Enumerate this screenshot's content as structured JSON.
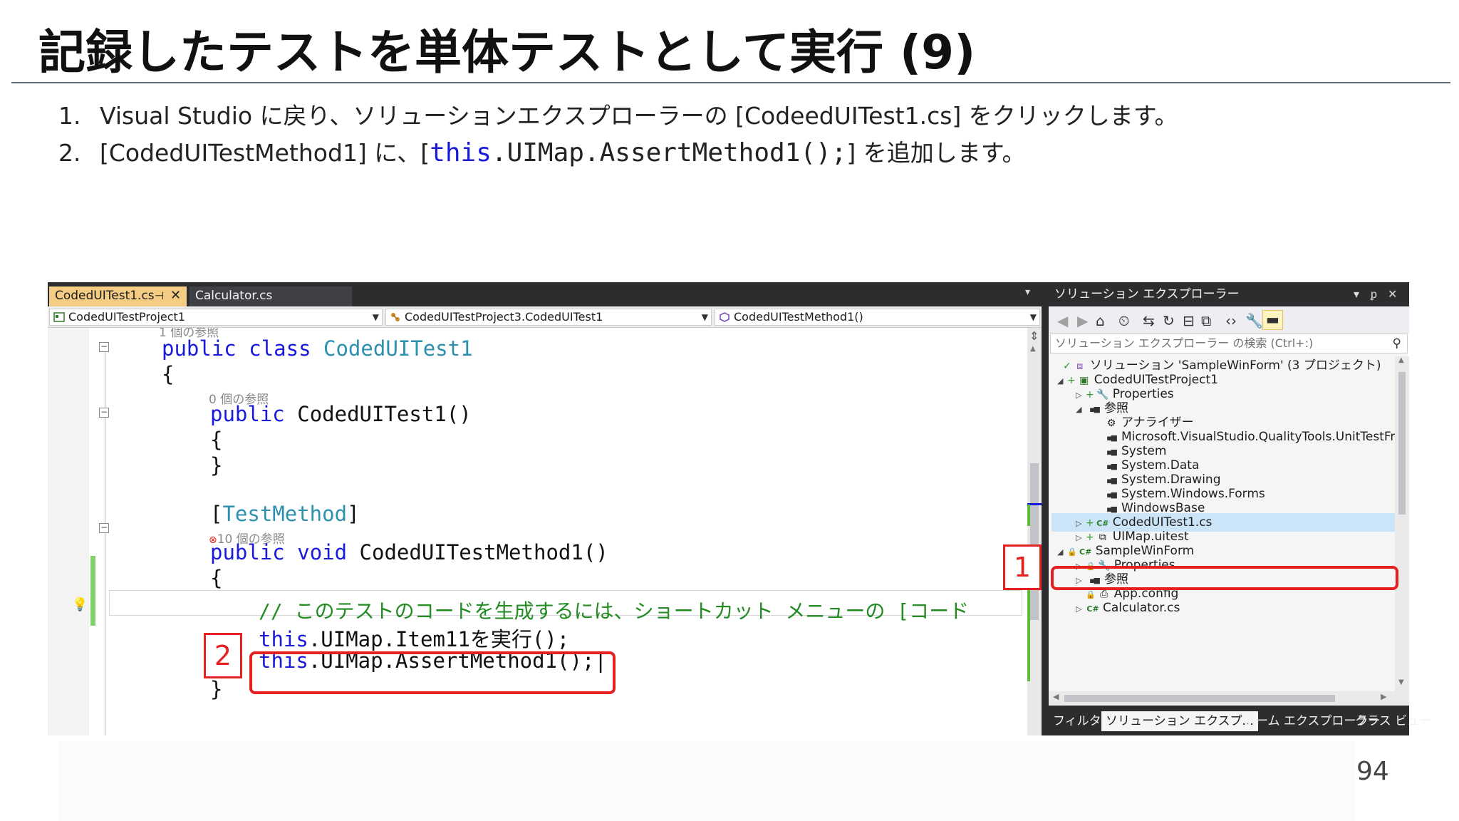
{
  "slide": {
    "title": "記録したテストを単体テストとして実行 (9)",
    "steps": [
      {
        "num": "1.",
        "text": "Visual Studio に戻り、ソリューションエクスプローラーの [CodeedUITest1.cs] をクリックします。"
      },
      {
        "num": "2.",
        "text_before": "[CodedUITestMethod1] に、[",
        "code_keyword": "this",
        "code_rest": ".UIMap.AssertMethod1();",
        "text_after": "] を追加します。"
      }
    ],
    "page_number": "94"
  },
  "editor": {
    "tabs": [
      {
        "label": "CodedUITest1.cs",
        "pin": "⊣",
        "close": "✕",
        "active": true
      },
      {
        "label": "Calculator.cs",
        "active": false
      }
    ],
    "tabs_dropdown": "▾",
    "nav": {
      "project": "CodedUITestProject1",
      "class": "CodedUITestProject3.CodedUITest1",
      "member": "CodedUITestMethod1()"
    },
    "lines": {
      "ref1": "1 個の参照",
      "class_kw1": "public",
      "class_kw2": "class",
      "class_name": "CodedUITest1",
      "brace_open": "{",
      "ref2": "0 個の参照",
      "ctor_kw": "public",
      "ctor_name": "CodedUITest1()",
      "ctor_open": "{",
      "ctor_close": "}",
      "attr_open": "[",
      "attr_name": "TestMethod",
      "attr_close": "]",
      "ref3_err": "⊗",
      "ref3": "10 個の参照",
      "method_kw1": "public",
      "method_kw2": "void",
      "method_name": "CodedUITestMethod1()",
      "method_open": "{",
      "comment": "// このテストのコードを生成するには、ショートカット メニューの [コード",
      "item_this": "this",
      "item_rest": ".UIMap.Item11を実行();",
      "assert_this": "this",
      "assert_rest": ".UIMap.AssertMethod1();",
      "method_close": "}"
    }
  },
  "solution_explorer": {
    "title": "ソリューション エクスプローラー",
    "title_controls": [
      "▾",
      "ᵱ",
      "✕"
    ],
    "search_placeholder": "ソリューション エクスプローラー の検索 (Ctrl+:)",
    "search_icon": "⚲",
    "tree": [
      {
        "label": "ソリューション 'SampleWinForm' (3 プロジェクト)",
        "icon": "solution-icon",
        "glyph": "⧈",
        "twisty": "",
        "plus": "✓"
      },
      {
        "label": "CodedUITestProject1",
        "icon": "project-icon",
        "glyph": "▣",
        "twisty": "◢",
        "plus": "+"
      },
      {
        "label": "Properties",
        "icon": "wrench-icon",
        "glyph": "🔧",
        "twisty": "▷",
        "plus": "+"
      },
      {
        "label": "参照",
        "icon": "references-icon",
        "glyph": "▪■",
        "twisty": "◢",
        "plus": ""
      },
      {
        "label": "アナライザー",
        "icon": "analyzer-icon",
        "glyph": "⚙",
        "twisty": "",
        "plus": ""
      },
      {
        "label": "Microsoft.VisualStudio.QualityTools.UnitTestFr",
        "icon": "reference-icon",
        "glyph": "▪■",
        "twisty": "",
        "plus": ""
      },
      {
        "label": "System",
        "icon": "reference-icon",
        "glyph": "▪■",
        "twisty": "",
        "plus": ""
      },
      {
        "label": "System.Data",
        "icon": "reference-icon",
        "glyph": "▪■",
        "twisty": "",
        "plus": ""
      },
      {
        "label": "System.Drawing",
        "icon": "reference-icon",
        "glyph": "▪■",
        "twisty": "",
        "plus": ""
      },
      {
        "label": "System.Windows.Forms",
        "icon": "reference-icon",
        "glyph": "▪■",
        "twisty": "",
        "plus": ""
      },
      {
        "label": "WindowsBase",
        "icon": "reference-icon",
        "glyph": "▪■",
        "twisty": "",
        "plus": ""
      },
      {
        "label": "CodedUITest1.cs",
        "icon": "csharp-file-icon",
        "glyph": "C#",
        "twisty": "▷",
        "plus": "+",
        "selected": true
      },
      {
        "label": "UIMap.uitest",
        "icon": "uimap-icon",
        "glyph": "⧉",
        "twisty": "▷",
        "plus": "+"
      },
      {
        "label": "SampleWinForm",
        "icon": "csharp-project-icon",
        "glyph": "C#",
        "twisty": "◢",
        "plus": "🔒"
      },
      {
        "label": "Properties",
        "icon": "wrench-icon",
        "glyph": "🔧",
        "twisty": "▷",
        "plus": "🔒"
      },
      {
        "label": "参照",
        "icon": "references-icon",
        "glyph": "▪■",
        "twisty": "▷",
        "plus": ""
      },
      {
        "label": "App.config",
        "icon": "config-icon",
        "glyph": "⎙",
        "twisty": "",
        "plus": "🔒"
      },
      {
        "label": "Calculator.cs",
        "icon": "csharp-file-icon",
        "glyph": "C#",
        "twisty": "▷",
        "plus": ""
      }
    ],
    "bottom_tabs": [
      "フィルター",
      "ソリューション エクスプ...",
      "チーム エクスプローラー",
      "クラス ビュー"
    ]
  },
  "callouts": {
    "one": "1",
    "two": "2"
  },
  "colors": {
    "callout_red": "#e52020",
    "keyword_blue": "#1a1adb",
    "type_teal": "#2b91af",
    "comment_green": "#228b22",
    "vs_dark": "#2d2d30",
    "active_tab": "#f5cc84"
  }
}
